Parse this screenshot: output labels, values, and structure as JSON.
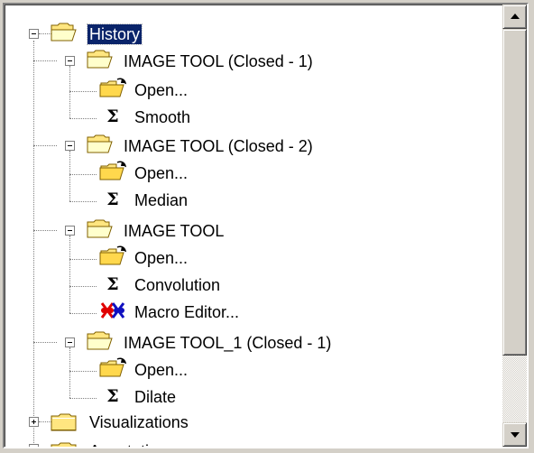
{
  "tree": {
    "root": {
      "label": "History",
      "selected": true,
      "expanded": true
    },
    "groups": [
      {
        "label": "IMAGE TOOL (Closed - 1)",
        "children": [
          {
            "label": "Open...",
            "icon": "open-folder-icon"
          },
          {
            "label": "Smooth",
            "icon": "sigma-icon"
          }
        ]
      },
      {
        "label": "IMAGE TOOL (Closed - 2)",
        "children": [
          {
            "label": "Open...",
            "icon": "open-folder-icon"
          },
          {
            "label": "Median",
            "icon": "sigma-icon"
          }
        ]
      },
      {
        "label": "IMAGE TOOL",
        "children": [
          {
            "label": "Open...",
            "icon": "open-folder-icon"
          },
          {
            "label": "Convolution",
            "icon": "sigma-icon"
          },
          {
            "label": "Macro Editor...",
            "icon": "macro-editor-icon"
          }
        ]
      },
      {
        "label": "IMAGE TOOL_1 (Closed - 1)",
        "children": [
          {
            "label": "Open...",
            "icon": "open-folder-icon"
          },
          {
            "label": "Dilate",
            "icon": "sigma-icon"
          }
        ]
      }
    ],
    "siblings": [
      {
        "label": "Visualizations",
        "expanded": false
      },
      {
        "label": "Annotations",
        "expanded": false
      }
    ]
  },
  "colors": {
    "selection_bg": "#0a246a",
    "folder_yellow": "#ffe680",
    "window_bg": "#d4d0c8"
  }
}
